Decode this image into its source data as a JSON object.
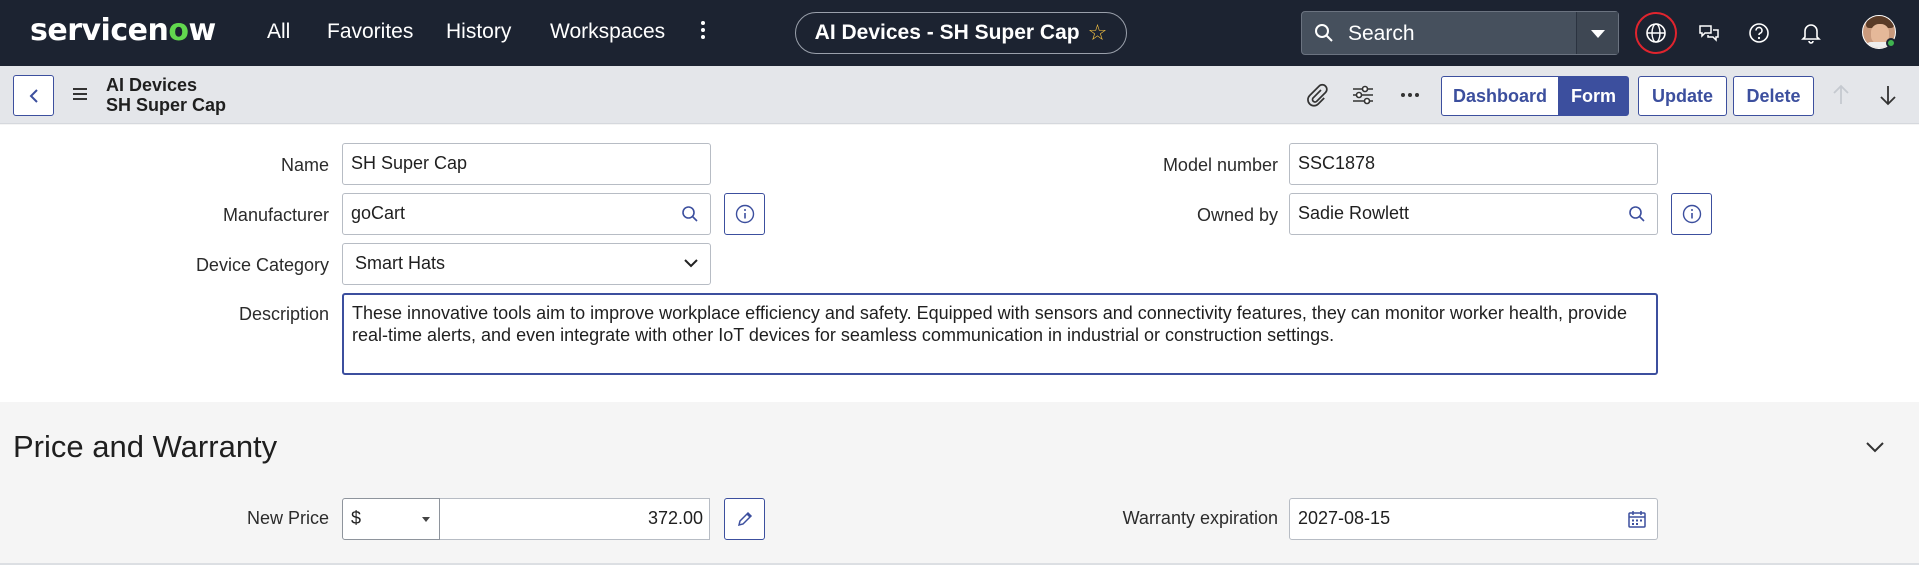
{
  "nav": {
    "logo_prefix": "servicen",
    "logo_o": "o",
    "logo_suffix": "w",
    "links": [
      "All",
      "Favorites",
      "History",
      "Workspaces"
    ],
    "context_title": "AI Devices - SH Super Cap",
    "search_placeholder": "Search"
  },
  "header": {
    "breadcrumb_table": "AI Devices",
    "breadcrumb_record": "SH Super Cap",
    "buttons": {
      "dashboard": "Dashboard",
      "form": "Form",
      "update": "Update",
      "delete": "Delete"
    }
  },
  "form": {
    "name": {
      "label": "Name",
      "value": "SH Super Cap"
    },
    "model_number": {
      "label": "Model number",
      "value": "SSC1878"
    },
    "manufacturer": {
      "label": "Manufacturer",
      "value": "goCart"
    },
    "owned_by": {
      "label": "Owned by",
      "value": "Sadie Rowlett"
    },
    "device_category": {
      "label": "Device Category",
      "value": "Smart Hats"
    },
    "description": {
      "label": "Description",
      "value": "These innovative tools aim to improve workplace efficiency and safety. Equipped with sensors and connectivity features, they can monitor worker health, provide real-time alerts, and even integrate with other IoT devices for seamless communication in industrial or construction settings."
    }
  },
  "price_section": {
    "title": "Price and Warranty",
    "new_price": {
      "label": "New Price",
      "currency": "$",
      "value": "372.00"
    },
    "warranty": {
      "label": "Warranty expiration",
      "value": "2027-08-15"
    }
  },
  "colors": {
    "nav_bg": "#1c2331",
    "accent": "#3c4f9e",
    "logo_green": "#62d84e",
    "alert_red": "#e0242e"
  }
}
